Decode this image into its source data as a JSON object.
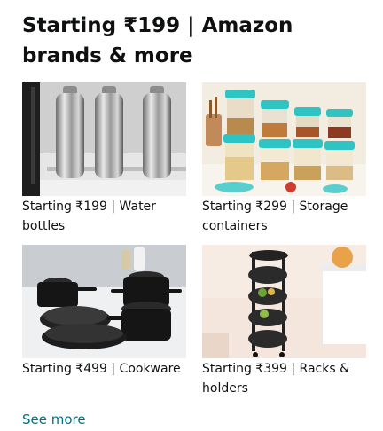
{
  "card": {
    "title": "Starting ₹199 | Amazon brands & more",
    "tiles": [
      {
        "label": "Starting ₹199 | Water bottles",
        "image": "water-bottles-image"
      },
      {
        "label": "Starting ₹299 | Storage containers",
        "image": "storage-containers-image"
      },
      {
        "label": "Starting ₹499 | Cookware",
        "image": "cookware-image"
      },
      {
        "label": "Starting ₹399 | Racks & holders",
        "image": "racks-holders-image"
      }
    ],
    "see_more": "See more"
  },
  "colors": {
    "link": "#007185",
    "text": "#0f1111"
  }
}
